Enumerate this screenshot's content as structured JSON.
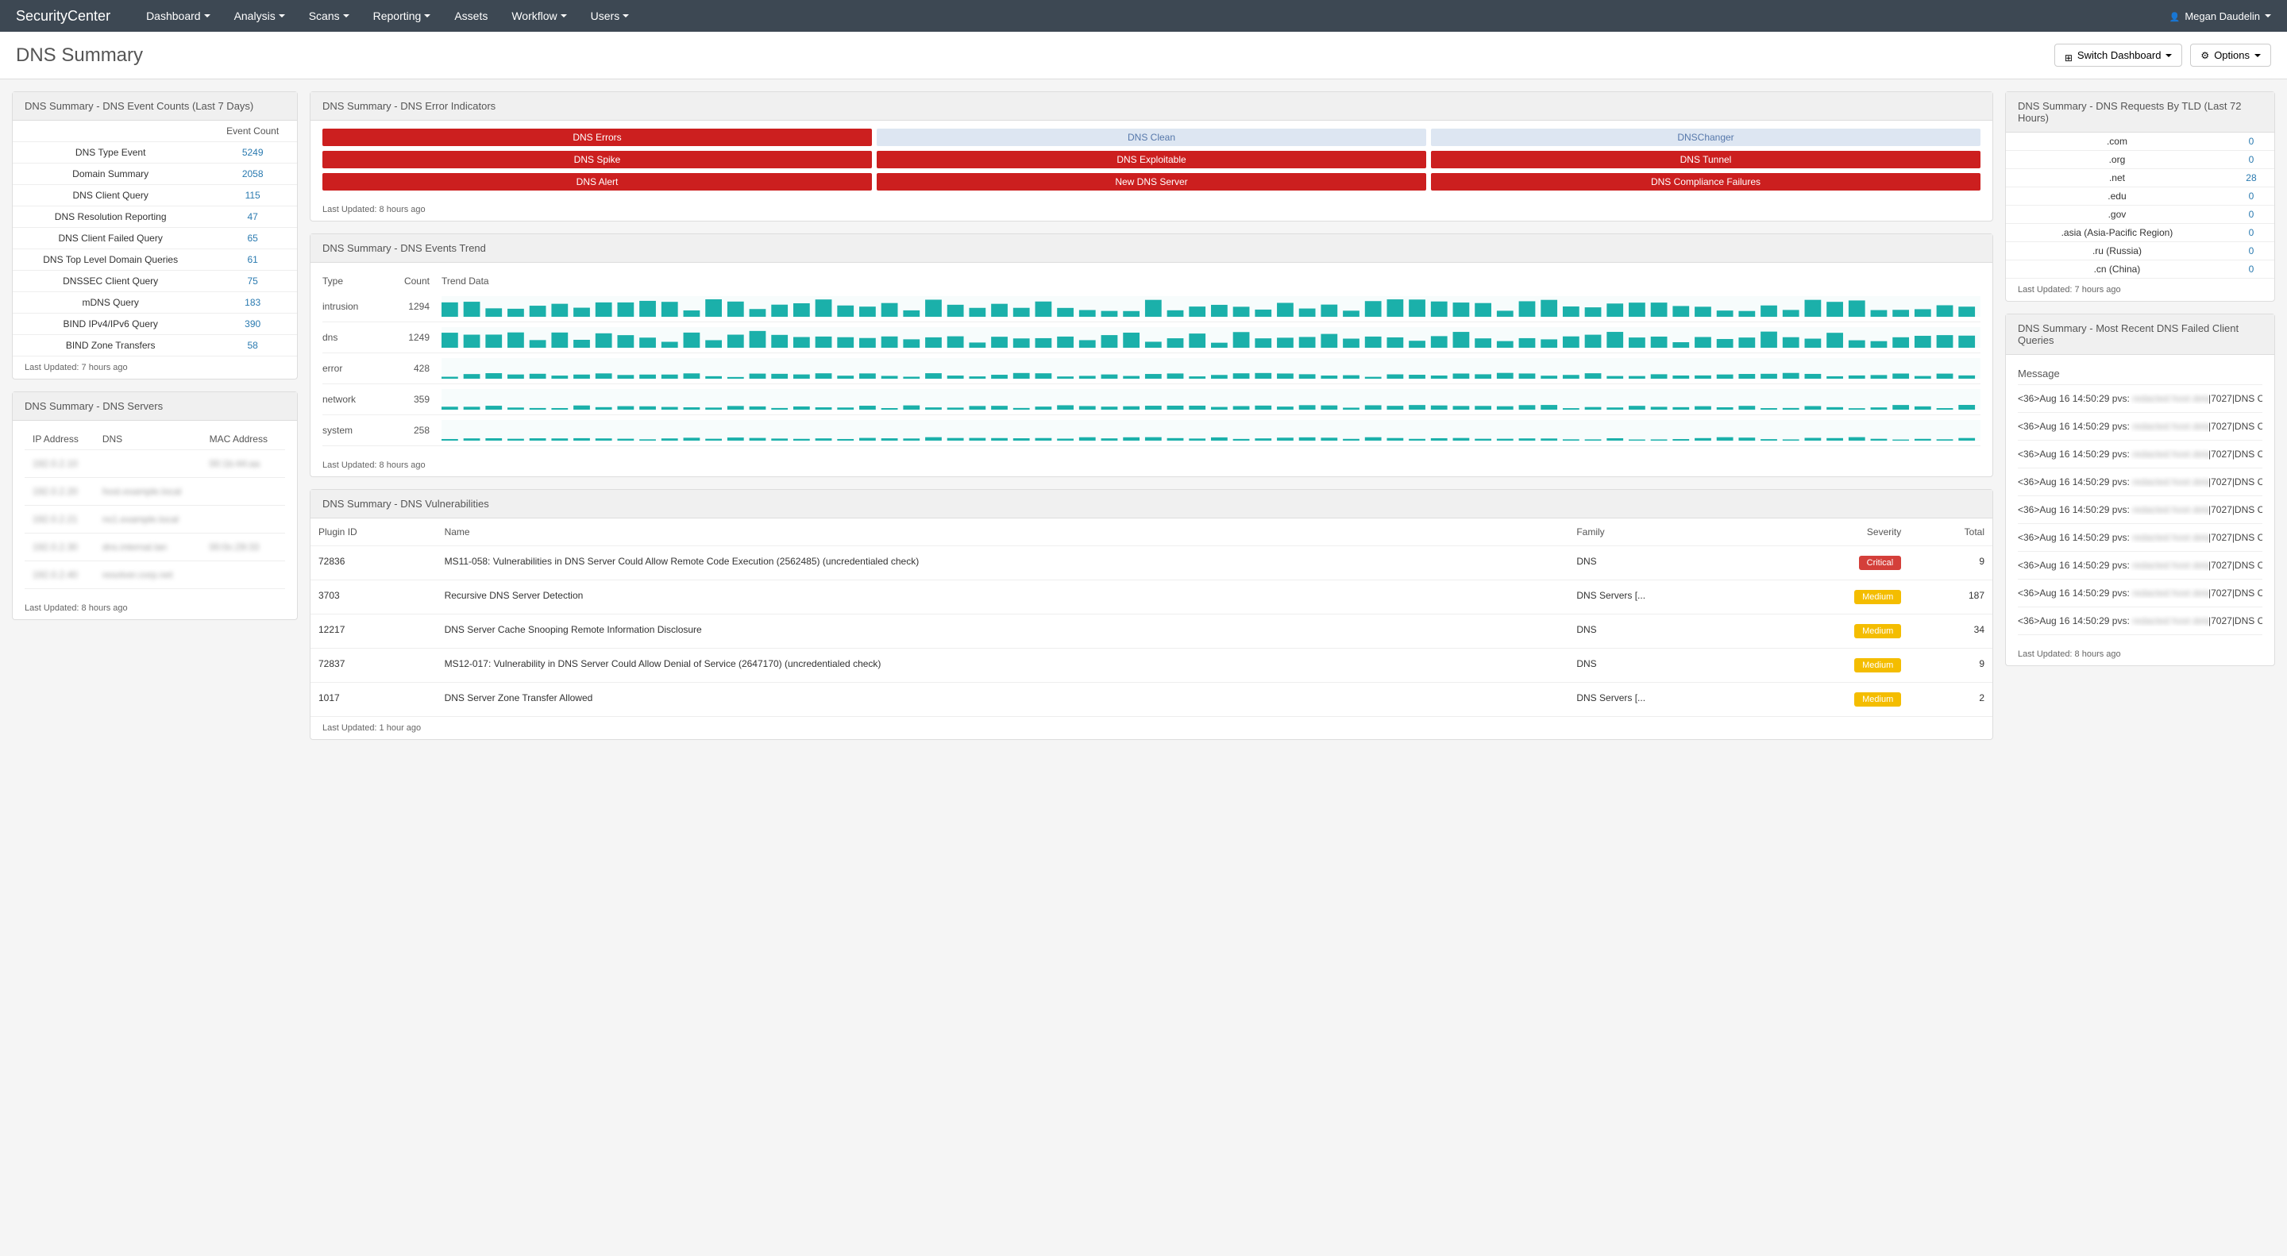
{
  "brand": {
    "prefix": "Security",
    "suffix": "Center"
  },
  "nav": [
    "Dashboard",
    "Analysis",
    "Scans",
    "Reporting",
    "Assets",
    "Workflow",
    "Users"
  ],
  "user": "Megan Daudelin",
  "pageTitle": "DNS Summary",
  "buttons": {
    "switch": "Switch Dashboard",
    "options": "Options"
  },
  "eventCounts": {
    "title": "DNS Summary - DNS Event Counts (Last 7 Days)",
    "header": "Event Count",
    "rows": [
      {
        "label": "DNS Type Event",
        "count": "5249"
      },
      {
        "label": "Domain Summary",
        "count": "2058"
      },
      {
        "label": "DNS Client Query",
        "count": "115"
      },
      {
        "label": "DNS Resolution Reporting",
        "count": "47"
      },
      {
        "label": "DNS Client Failed Query",
        "count": "65"
      },
      {
        "label": "DNS Top Level Domain Queries",
        "count": "61"
      },
      {
        "label": "DNSSEC Client Query",
        "count": "75"
      },
      {
        "label": "mDNS Query",
        "count": "183"
      },
      {
        "label": "BIND IPv4/IPv6 Query",
        "count": "390"
      },
      {
        "label": "BIND Zone Transfers",
        "count": "58"
      }
    ],
    "updated": "Last Updated: 7 hours ago"
  },
  "servers": {
    "title": "DNS Summary - DNS Servers",
    "headers": [
      "IP Address",
      "DNS",
      "MAC Address"
    ],
    "rows": [
      {
        "ip": "192.0.2.10",
        "dns": "",
        "mac": "00:1b:44:aa"
      },
      {
        "ip": "192.0.2.20",
        "dns": "host.example.local",
        "mac": ""
      },
      {
        "ip": "192.0.2.21",
        "dns": "ns1.example.local",
        "mac": ""
      },
      {
        "ip": "192.0.2.30",
        "dns": "dns.internal.lan",
        "mac": "00:0c:29:33"
      },
      {
        "ip": "192.0.2.40",
        "dns": "resolver.corp.net",
        "mac": ""
      }
    ],
    "updated": "Last Updated: 8 hours ago"
  },
  "indicators": {
    "title": "DNS Summary - DNS Error Indicators",
    "items": [
      {
        "label": "DNS Errors",
        "cls": "ind-red"
      },
      {
        "label": "DNS Clean",
        "cls": "ind-blue"
      },
      {
        "label": "DNSChanger",
        "cls": "ind-blue"
      },
      {
        "label": "DNS Spike",
        "cls": "ind-red"
      },
      {
        "label": "DNS Exploitable",
        "cls": "ind-red"
      },
      {
        "label": "DNS Tunnel",
        "cls": "ind-red"
      },
      {
        "label": "DNS Alert",
        "cls": "ind-red"
      },
      {
        "label": "New DNS Server",
        "cls": "ind-red"
      },
      {
        "label": "DNS Compliance Failures",
        "cls": "ind-red"
      }
    ],
    "updated": "Last Updated: 8 hours ago"
  },
  "chart_data": {
    "title": "DNS Summary - DNS Events Trend",
    "headers": [
      "Type",
      "Count",
      "Trend Data"
    ],
    "type": "bar",
    "series": [
      {
        "name": "intrusion",
        "count": 1294
      },
      {
        "name": "dns",
        "count": 1249
      },
      {
        "name": "error",
        "count": 428
      },
      {
        "name": "network",
        "count": 359
      },
      {
        "name": "system",
        "count": 258
      }
    ],
    "updated": "Last Updated: 8 hours ago"
  },
  "vulns": {
    "title": "DNS Summary - DNS Vulnerabilities",
    "headers": [
      "Plugin ID",
      "Name",
      "Family",
      "Severity",
      "Total"
    ],
    "rows": [
      {
        "id": "72836",
        "name": "MS11-058: Vulnerabilities in DNS Server Could Allow Remote Code Execution (2562485) (uncredentialed check)",
        "family": "DNS",
        "severity": "Critical",
        "sevcls": "badge-critical",
        "total": "9"
      },
      {
        "id": "3703",
        "name": "Recursive DNS Server Detection",
        "family": "DNS Servers [...",
        "severity": "Medium",
        "sevcls": "badge-medium",
        "total": "187"
      },
      {
        "id": "12217",
        "name": "DNS Server Cache Snooping Remote Information Disclosure",
        "family": "DNS",
        "severity": "Medium",
        "sevcls": "badge-medium",
        "total": "34"
      },
      {
        "id": "72837",
        "name": "MS12-017: Vulnerability in DNS Server Could Allow Denial of Service (2647170) (uncredentialed check)",
        "family": "DNS",
        "severity": "Medium",
        "sevcls": "badge-medium",
        "total": "9"
      },
      {
        "id": "1017",
        "name": "DNS Server Zone Transfer Allowed",
        "family": "DNS Servers [...",
        "severity": "Medium",
        "sevcls": "badge-medium",
        "total": "2"
      }
    ],
    "updated": "Last Updated: 1 hour ago"
  },
  "tld": {
    "title": "DNS Summary - DNS Requests By TLD (Last 72 Hours)",
    "rows": [
      {
        "label": ".com",
        "count": "0"
      },
      {
        "label": ".org",
        "count": "0"
      },
      {
        "label": ".net",
        "count": "28"
      },
      {
        "label": ".edu",
        "count": "0"
      },
      {
        "label": ".gov",
        "count": "0"
      },
      {
        "label": ".asia (Asia-Pacific Region)",
        "count": "0"
      },
      {
        "label": ".ru (Russia)",
        "count": "0"
      },
      {
        "label": ".cn (China)",
        "count": "0"
      }
    ],
    "updated": "Last Updated: 7 hours ago"
  },
  "failed": {
    "title": "DNS Summary - Most Recent DNS Failed Client Queries",
    "header": "Message",
    "prefix": "<36>Aug 16 14:50:29 pvs:",
    "tail": "|7027|DNS C",
    "count": 9,
    "updated": "Last Updated: 8 hours ago"
  }
}
